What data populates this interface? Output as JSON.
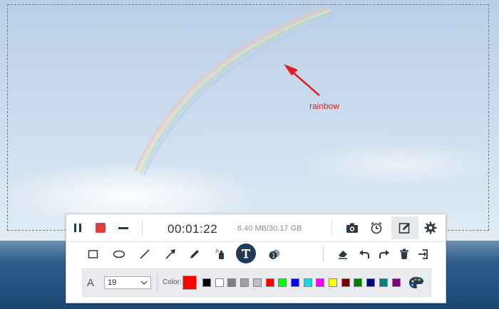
{
  "annotation": {
    "text": "rainbow",
    "color": "#e31b1b"
  },
  "toolbar": {
    "timer": "00:01:22",
    "file_size": "8.40 MB/30.17 GB",
    "accent": "#e03e3e",
    "icons_row1": [
      "pause-icon",
      "stop-icon",
      "minimize-icon",
      "camera-icon",
      "schedule-icon",
      "edit-icon",
      "gear-icon"
    ],
    "icons_row2": [
      "rectangle-icon",
      "ellipse-icon",
      "line-icon",
      "arrow-icon",
      "pencil-icon",
      "spray-icon",
      "text-icon",
      "callout-icon",
      "eraser-icon",
      "undo-icon",
      "redo-icon",
      "trash-icon",
      "exit-icon"
    ]
  },
  "text_options": {
    "font_label": "A",
    "font_size": "19",
    "color_label": "Color:",
    "current_color": "#ff0000",
    "palette": [
      "#000000",
      "#ffffff",
      "#808080",
      "#a0a0a0",
      "#c0c0c0",
      "#ff0000",
      "#00ff00",
      "#0000ff",
      "#00e5e5",
      "#ff00ff",
      "#ffff00",
      "#800000",
      "#008000",
      "#000080",
      "#008080",
      "#800080"
    ]
  }
}
